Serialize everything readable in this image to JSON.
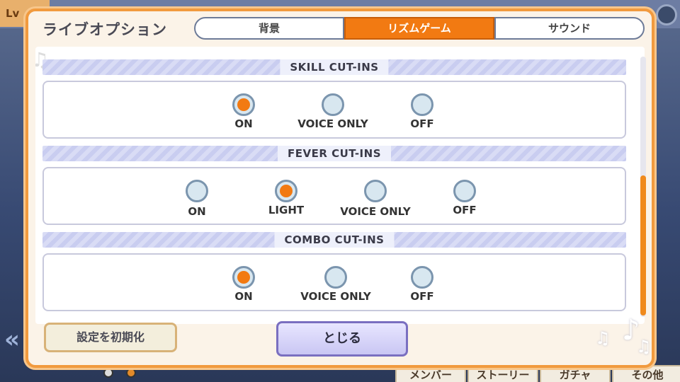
{
  "background": {
    "lv_label": "Lv",
    "bottom_nav": [
      "メンバー",
      "ストーリー",
      "ガチャ",
      "その他"
    ]
  },
  "dialog": {
    "title": "ライブオプション",
    "tabs": [
      {
        "label": "背景",
        "active": false
      },
      {
        "label": "リズムゲーム",
        "active": true
      },
      {
        "label": "サウンド",
        "active": false
      }
    ],
    "sections": [
      {
        "header": "SKILL CUT-INS",
        "options": [
          {
            "label": "ON",
            "selected": true
          },
          {
            "label": "VOICE ONLY",
            "selected": false
          },
          {
            "label": "OFF",
            "selected": false
          }
        ]
      },
      {
        "header": "FEVER CUT-INS",
        "options": [
          {
            "label": "ON",
            "selected": false
          },
          {
            "label": "LIGHT",
            "selected": true
          },
          {
            "label": "VOICE ONLY",
            "selected": false
          },
          {
            "label": "OFF",
            "selected": false
          }
        ]
      },
      {
        "header": "COMBO CUT-INS",
        "options": [
          {
            "label": "ON",
            "selected": true
          },
          {
            "label": "VOICE ONLY",
            "selected": false
          },
          {
            "label": "OFF",
            "selected": false
          }
        ]
      }
    ],
    "reset_label": "設定を初期化",
    "close_label": "とじる"
  },
  "colors": {
    "accent": "#f27a12",
    "frame": "#f19a3e",
    "radio_border": "#7b95ae"
  }
}
